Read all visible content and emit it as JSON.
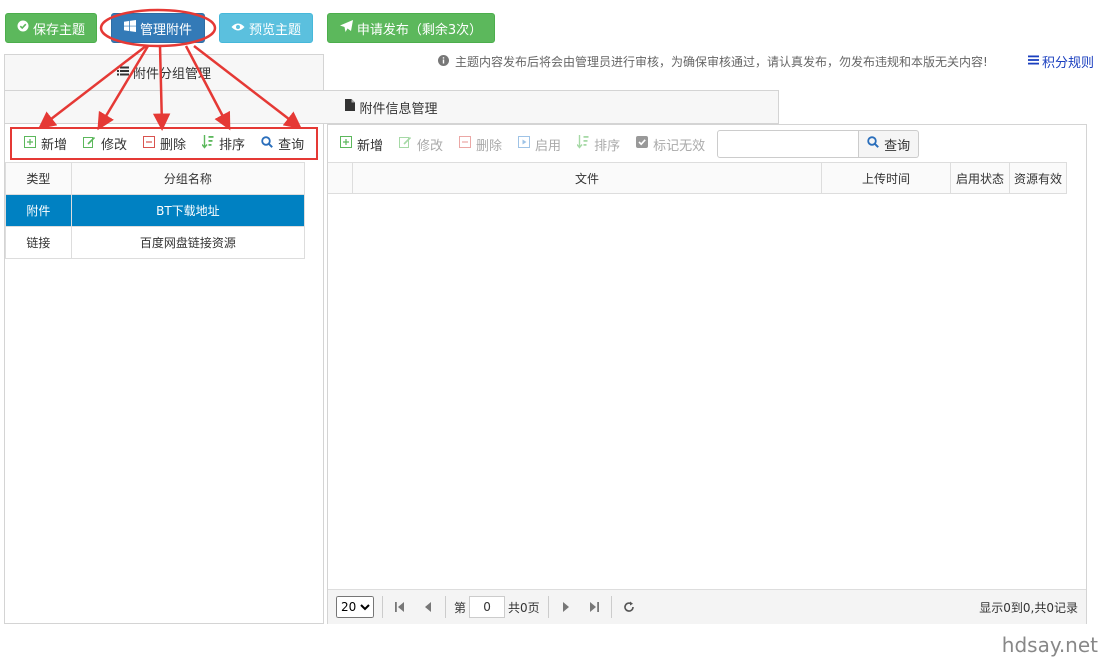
{
  "top_buttons": {
    "save": "保存主题",
    "manage": "管理附件",
    "preview": "预览主题",
    "publish": "申请发布（剩余3次）"
  },
  "notice": "主题内容发布后将会由管理员进行审核，为确保审核通过，请认真发布，勿发布违规和本版无关内容!",
  "rules_link": "积分规则",
  "tabs": {
    "group_mgmt": "附件分组管理",
    "info_mgmt": "附件信息管理"
  },
  "left_toolbar": {
    "add": "新增",
    "edit": "修改",
    "delete": "删除",
    "sort": "排序",
    "query": "查询"
  },
  "left_table": {
    "columns": [
      "类型",
      "分组名称"
    ],
    "rows": [
      {
        "type": "附件",
        "name": "BT下载地址",
        "selected": true
      },
      {
        "type": "链接",
        "name": "百度网盘链接资源",
        "selected": false
      }
    ]
  },
  "right_toolbar": {
    "add": "新增",
    "edit": "修改",
    "delete": "删除",
    "enable": "启用",
    "sort": "排序",
    "mark_invalid": "标记无效",
    "search_placeholder": "",
    "query": "查询"
  },
  "right_table": {
    "columns": [
      "文件",
      "上传时间",
      "启用状态",
      "资源有效"
    ]
  },
  "pager": {
    "page_size": "20",
    "page_prefix": "第",
    "page_value": "0",
    "page_suffix": "共0页",
    "info": "显示0到0,共0记录"
  },
  "watermark": "hdsay.net",
  "colors": {
    "green": "#5cb85c",
    "blue": "#337ab7",
    "cyan": "#5bc0de",
    "selected_row": "#0081c2",
    "annotation": "#e53935"
  }
}
